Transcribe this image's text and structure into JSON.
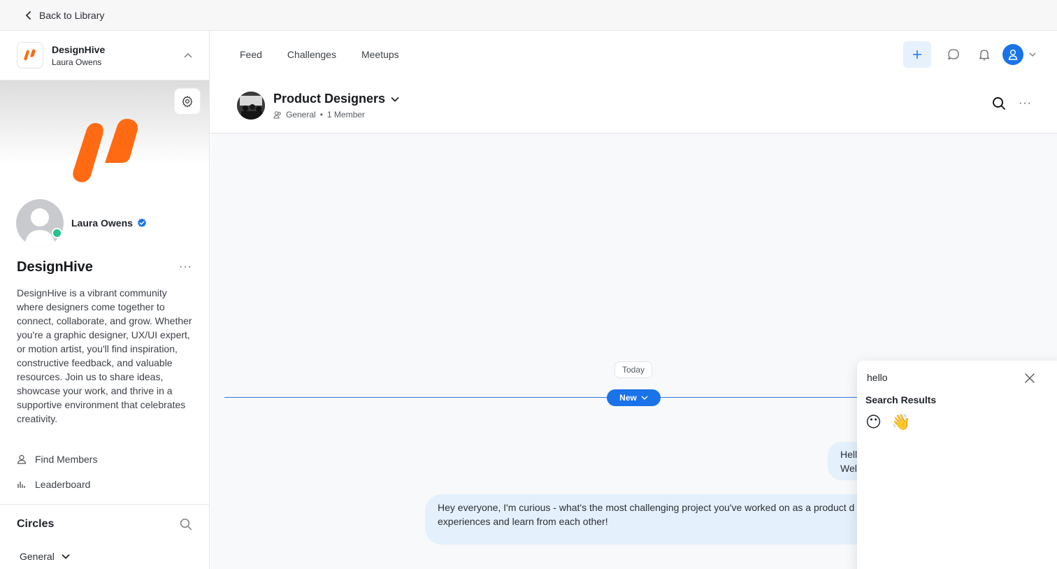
{
  "topbar": {
    "back_label": "Back to Library"
  },
  "sidebar": {
    "community_name": "DesignHive",
    "community_user": "Laura Owens",
    "profile_name": "Laura Owens",
    "title": "DesignHive",
    "description": "DesignHive is a vibrant community where designers come together to connect, collaborate, and grow. Whether you're a graphic designer, UX/UI expert, or motion artist, you'll find inspiration, constructive feedback, and valuable resources. Join us to share ideas, showcase your work, and thrive in a supportive environment that celebrates creativity.",
    "links": [
      {
        "label": "Find Members",
        "icon": "person-icon"
      },
      {
        "label": "Leaderboard",
        "icon": "bar-chart-icon"
      }
    ],
    "circles_title": "Circles",
    "general_label": "General"
  },
  "nav": {
    "tabs": [
      "Feed",
      "Challenges",
      "Meetups"
    ]
  },
  "channel": {
    "title": "Product Designers",
    "category": "General",
    "members": "1 Member"
  },
  "chat": {
    "today_label": "Today",
    "new_label": "New",
    "message1_line1": "Hell",
    "message1_line2": "Wel",
    "message2_line1": "Hey everyone, I'm curious - what's the most challenging project you've worked on as a product d",
    "message2_line2": "experiences and learn from each other!"
  },
  "emoji_search": {
    "query": "hello",
    "results_title": "Search Results",
    "results": [
      "😶",
      "👋"
    ]
  },
  "colors": {
    "brand_orange": "#ff6a13",
    "accent_blue": "#1a73e8",
    "online_green": "#28c28a"
  }
}
